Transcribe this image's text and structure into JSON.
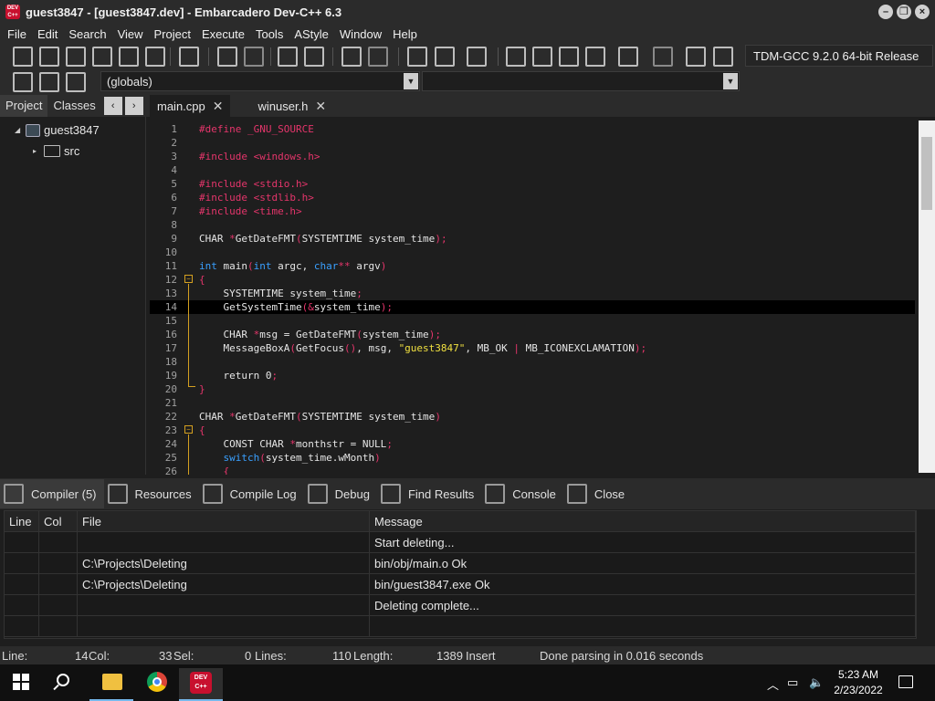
{
  "window": {
    "title": "guest3847 - [guest3847.dev] - Embarcadero Dev-C++ 6.3",
    "app_icon_text": "DEV C++"
  },
  "menu": [
    "File",
    "Edit",
    "Search",
    "View",
    "Project",
    "Execute",
    "Tools",
    "AStyle",
    "Window",
    "Help"
  ],
  "toolbar": {
    "compiler_label": "TDM-GCC 9.2.0 64-bit Release",
    "scope_combo": "(globals)",
    "icons": [
      "new-file-icon",
      "open-icon",
      "save-icon",
      "save-all-icon",
      "close-file-icon",
      "close-all-icon",
      "print-icon",
      "find-icon",
      "replace-icon",
      "goto-icon",
      "toggle-icon",
      "undo-icon",
      "redo-icon",
      "indent-icon",
      "unindent-icon",
      "comment-icon",
      "compile-icon",
      "run-icon",
      "compile-run-icon",
      "rebuild-icon",
      "check-icon",
      "stop-icon",
      "profile-icon",
      "delete-profile-icon"
    ]
  },
  "left_panel": {
    "tabs": [
      "Project",
      "Classes"
    ],
    "tree": {
      "project": "guest3847",
      "folder": "src"
    }
  },
  "editor": {
    "tabs": [
      {
        "label": "main.cpp",
        "active": true
      },
      {
        "label": "winuser.h",
        "active": false
      }
    ],
    "current_line": 14,
    "lines": [
      {
        "n": "1",
        "text": "#define _GNU_SOURCE"
      },
      {
        "n": "2",
        "text": ""
      },
      {
        "n": "3",
        "text": "#include <windows.h>"
      },
      {
        "n": "4",
        "text": ""
      },
      {
        "n": "5",
        "text": "#include <stdio.h>"
      },
      {
        "n": "6",
        "text": "#include <stdlib.h>"
      },
      {
        "n": "7",
        "text": "#include <time.h>"
      },
      {
        "n": "8",
        "text": ""
      },
      {
        "n": "9",
        "text": "CHAR *GetDateFMT(SYSTEMTIME system_time);"
      },
      {
        "n": "10",
        "text": ""
      },
      {
        "n": "11",
        "text": "int main(int argc, char** argv)"
      },
      {
        "n": "12",
        "text": "{"
      },
      {
        "n": "13",
        "text": "    SYSTEMTIME system_time;"
      },
      {
        "n": "14",
        "text": "    GetSystemTime(&system_time);"
      },
      {
        "n": "15",
        "text": ""
      },
      {
        "n": "16",
        "text": "    CHAR *msg = GetDateFMT(system_time);"
      },
      {
        "n": "17",
        "text": "    MessageBoxA(GetFocus(), msg, \"guest3847\", MB_OK | MB_ICONEXCLAMATION);"
      },
      {
        "n": "18",
        "text": ""
      },
      {
        "n": "19",
        "text": "    return 0;"
      },
      {
        "n": "20",
        "text": "}"
      },
      {
        "n": "21",
        "text": ""
      },
      {
        "n": "22",
        "text": "CHAR *GetDateFMT(SYSTEMTIME system_time)"
      },
      {
        "n": "23",
        "text": "{"
      },
      {
        "n": "24",
        "text": "    CONST CHAR *monthstr = NULL;"
      },
      {
        "n": "25",
        "text": "    switch(system_time.wMonth)"
      },
      {
        "n": "26",
        "text": "    {"
      }
    ]
  },
  "bottom_tabs": [
    "Compiler (5)",
    "Resources",
    "Compile Log",
    "Debug",
    "Find Results",
    "Console",
    "Close"
  ],
  "compiler_table": {
    "headers": [
      "Line",
      "Col",
      "File",
      "Message"
    ],
    "rows": [
      [
        "",
        "",
        "",
        "Start deleting..."
      ],
      [
        "",
        "",
        "C:\\Projects\\Deleting",
        "bin/obj/main.o Ok"
      ],
      [
        "",
        "",
        "C:\\Projects\\Deleting",
        "bin/guest3847.exe Ok"
      ],
      [
        "",
        "",
        "",
        "Deleting complete..."
      ],
      [
        "",
        "",
        "",
        ""
      ]
    ]
  },
  "status": {
    "line_label": "Line:",
    "line_value": "14",
    "col_label": "Col:",
    "col_value": "33",
    "sel_label": "Sel:",
    "sel_value": "0",
    "lines_label": "Lines:",
    "lines_value": "110",
    "length_label": "Length:",
    "length_value": "1389",
    "mode": "Insert",
    "message": "Done parsing in 0.016 seconds"
  },
  "taskbar": {
    "time": "5:23 AM",
    "date": "2/23/2022",
    "apps": [
      "file-explorer-icon",
      "chrome-icon",
      "devcpp-icon"
    ]
  }
}
